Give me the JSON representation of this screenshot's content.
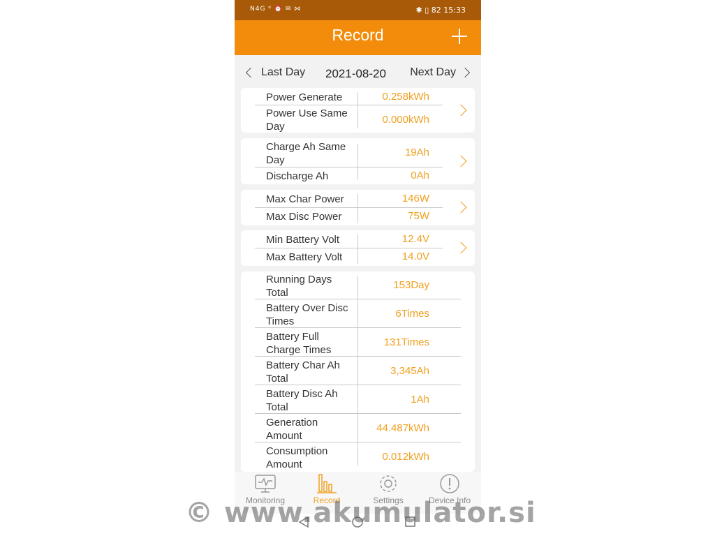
{
  "status": {
    "left": "N4G ᵈ ⏰ ✉ ⋈",
    "right": "✱ ▯ 82 15:33"
  },
  "header": {
    "title": "Record"
  },
  "daynav": {
    "prev": "Last Day",
    "date": "2021-08-20",
    "next": "Next Day"
  },
  "cards": [
    {
      "rows": [
        {
          "label": "Power Generate",
          "value": "0.258kWh"
        },
        {
          "label": "Power Use Same Day",
          "value": "0.000kWh"
        }
      ]
    },
    {
      "rows": [
        {
          "label": "Charge Ah Same Day",
          "value": "19Ah"
        },
        {
          "label": "Discharge Ah",
          "value": "0Ah"
        }
      ]
    },
    {
      "rows": [
        {
          "label": "Max Char Power",
          "value": "146W"
        },
        {
          "label": "Max Disc Power",
          "value": "75W"
        }
      ]
    },
    {
      "rows": [
        {
          "label": "Min Battery Volt",
          "value": "12.4V"
        },
        {
          "label": "Max Battery Volt",
          "value": "14.0V"
        }
      ]
    }
  ],
  "totals": [
    {
      "label": "Running Days Total",
      "value": "153Day"
    },
    {
      "label": "Battery Over Disc Times",
      "value": "6Times"
    },
    {
      "label": "Battery Full Charge Times",
      "value": "131Times"
    },
    {
      "label": "Battery Char Ah Total",
      "value": "3,345Ah"
    },
    {
      "label": "Battery Disc Ah Total",
      "value": "1Ah"
    },
    {
      "label": "Generation Amount",
      "value": "44.487kWh"
    },
    {
      "label": "Consumption Amount",
      "value": "0.012kWh"
    }
  ],
  "nav": {
    "tabs": [
      {
        "label": "Monitoring",
        "icon": "monitor-icon"
      },
      {
        "label": "Record",
        "icon": "bar-chart-icon",
        "active": true
      },
      {
        "label": "Settings",
        "icon": "gear-icon"
      },
      {
        "label": "Device Info",
        "icon": "info-icon"
      }
    ]
  },
  "watermark": "© www.akumulator.si",
  "colors": {
    "accent": "#f28c0a",
    "value": "#f0a020",
    "statusbar": "#a85a08"
  }
}
